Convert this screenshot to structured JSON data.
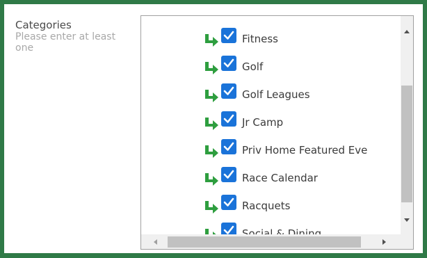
{
  "field": {
    "title": "Categories",
    "hint": "Please enter at least one"
  },
  "categories": [
    {
      "label": "Fitness",
      "checked": true
    },
    {
      "label": "Golf",
      "checked": true
    },
    {
      "label": "Golf Leagues",
      "checked": true
    },
    {
      "label": "Jr Camp",
      "checked": true
    },
    {
      "label": "Priv Home Featured Eve",
      "checked": true
    },
    {
      "label": "Race Calendar",
      "checked": true
    },
    {
      "label": "Racquets",
      "checked": true
    },
    {
      "label": "Social & Dining",
      "checked": true
    }
  ],
  "icons": {
    "row_icon": "arrow-return-right-icon",
    "checkbox": "checked-checkbox-icon"
  },
  "colors": {
    "frame": "#2f7a47",
    "arrow": "#2e9e3f",
    "checkbox": "#1a73d9"
  }
}
